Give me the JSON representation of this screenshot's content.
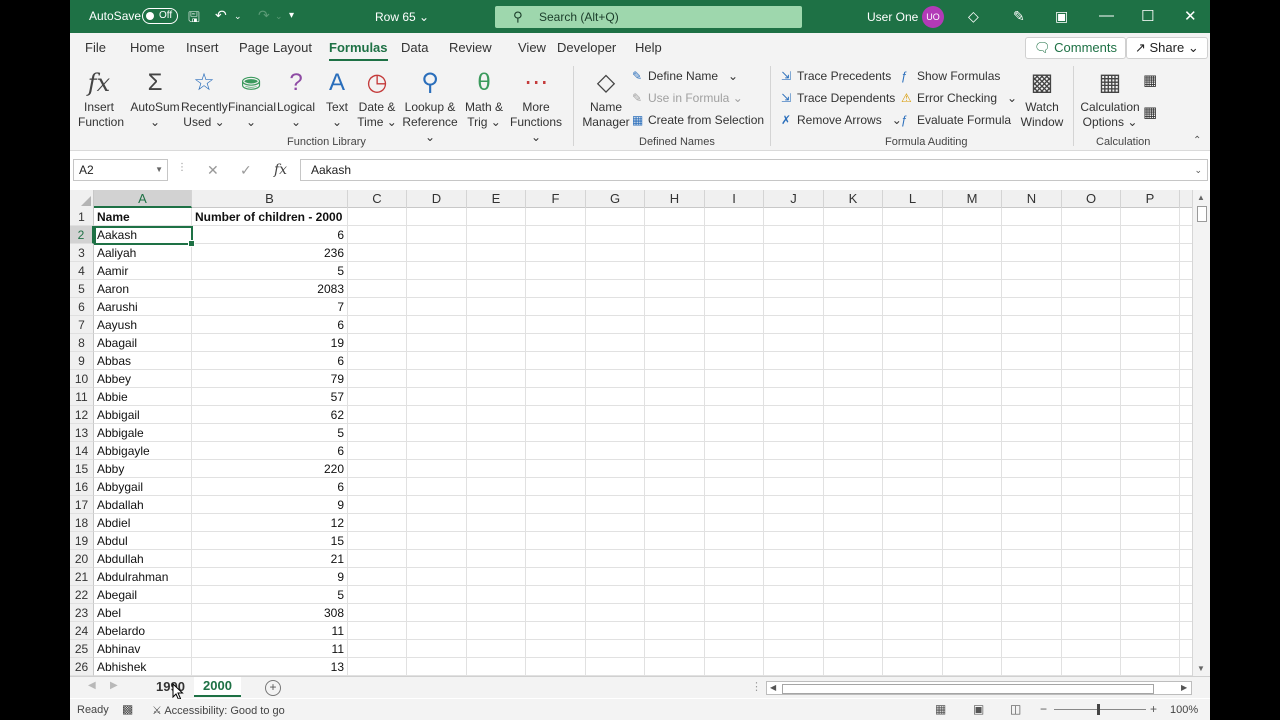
{
  "titlebar": {
    "autosave_label": "AutoSave",
    "autosave_state": "Off",
    "document": "Row 65",
    "search_placeholder": "Search (Alt+Q)",
    "user_name": "User One",
    "user_initials": "UO"
  },
  "tabs": [
    "File",
    "Home",
    "Insert",
    "Page Layout",
    "Formulas",
    "Data",
    "Review",
    "View",
    "Developer",
    "Help"
  ],
  "active_tab": "Formulas",
  "header_buttons": {
    "comments": "Comments",
    "share": "Share"
  },
  "ribbon": {
    "function_library": {
      "label": "Function Library",
      "insert_function": [
        "Insert",
        "Function"
      ],
      "autosum": "AutoSum",
      "recently_used": [
        "Recently",
        "Used"
      ],
      "financial": "Financial",
      "logical": "Logical",
      "text": "Text",
      "date_time": [
        "Date &",
        "Time"
      ],
      "lookup_reference": [
        "Lookup &",
        "Reference"
      ],
      "math_trig": [
        "Math &",
        "Trig"
      ],
      "more_functions": [
        "More",
        "Functions"
      ]
    },
    "defined_names": {
      "label": "Defined Names",
      "name_manager": [
        "Name",
        "Manager"
      ],
      "define_name": "Define Name",
      "use_in_formula": "Use in Formula",
      "create_from_selection": "Create from Selection"
    },
    "formula_auditing": {
      "label": "Formula Auditing",
      "trace_precedents": "Trace Precedents",
      "trace_dependents": "Trace Dependents",
      "remove_arrows": "Remove Arrows",
      "show_formulas": "Show Formulas",
      "error_checking": "Error Checking",
      "evaluate_formula": "Evaluate Formula",
      "watch_window": [
        "Watch",
        "Window"
      ]
    },
    "calculation": {
      "label": "Calculation",
      "calculation_options": [
        "Calculation",
        "Options"
      ]
    }
  },
  "formula_bar": {
    "name_box": "A2",
    "content": "Aakash"
  },
  "columns": [
    "A",
    "B",
    "C",
    "D",
    "E",
    "F",
    "G",
    "H",
    "I",
    "J",
    "K",
    "L",
    "M",
    "N",
    "O",
    "P"
  ],
  "table": {
    "header": [
      "Name",
      "Number of children - 2000"
    ],
    "rows": [
      [
        "Aakash",
        "6"
      ],
      [
        "Aaliyah",
        "236"
      ],
      [
        "Aamir",
        "5"
      ],
      [
        "Aaron",
        "2083"
      ],
      [
        "Aarushi",
        "7"
      ],
      [
        "Aayush",
        "6"
      ],
      [
        "Abagail",
        "19"
      ],
      [
        "Abbas",
        "6"
      ],
      [
        "Abbey",
        "79"
      ],
      [
        "Abbie",
        "57"
      ],
      [
        "Abbigail",
        "62"
      ],
      [
        "Abbigale",
        "5"
      ],
      [
        "Abbigayle",
        "6"
      ],
      [
        "Abby",
        "220"
      ],
      [
        "Abbygail",
        "6"
      ],
      [
        "Abdallah",
        "9"
      ],
      [
        "Abdiel",
        "12"
      ],
      [
        "Abdul",
        "15"
      ],
      [
        "Abdullah",
        "21"
      ],
      [
        "Abdulrahman",
        "9"
      ],
      [
        "Abegail",
        "5"
      ],
      [
        "Abel",
        "308"
      ],
      [
        "Abelardo",
        "11"
      ],
      [
        "Abhinav",
        "11"
      ],
      [
        "Abhishek",
        "13"
      ]
    ]
  },
  "sheet_tabs": [
    "1990",
    "2000"
  ],
  "active_sheet": "2000",
  "status": {
    "ready": "Ready",
    "accessibility": "Accessibility: Good to go",
    "zoom": "100%"
  }
}
